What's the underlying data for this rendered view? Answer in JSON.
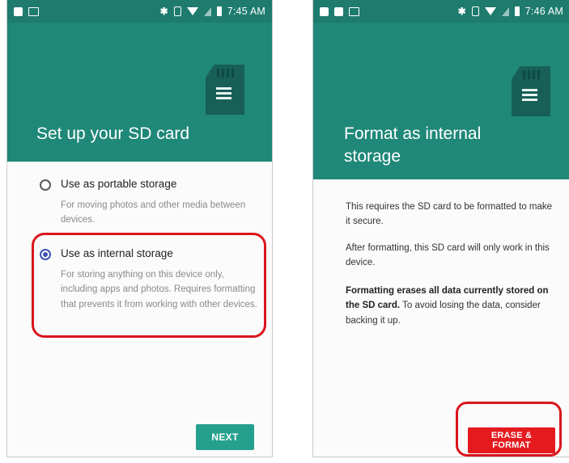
{
  "screen1": {
    "status": {
      "time": "7:45 AM",
      "left_icons": [
        "sim-icon",
        "image-icon"
      ],
      "right_icons": [
        "bluetooth-icon",
        "vibrate-icon",
        "wifi-icon",
        "signal-icon",
        "battery-icon"
      ]
    },
    "title": "Set up your SD card",
    "options": [
      {
        "label": "Use as portable storage",
        "description": "For moving photos and other media between devices.",
        "selected": false
      },
      {
        "label": "Use as internal storage",
        "description": "For storing anything on this device only, including apps and photos. Requires formatting that prevents it from working with other devices.",
        "selected": true
      }
    ],
    "next_label": "NEXT"
  },
  "screen2": {
    "status": {
      "time": "7:46 AM",
      "left_icons": [
        "photo-icon",
        "sim-icon",
        "image-icon"
      ],
      "right_icons": [
        "bluetooth-icon",
        "vibrate-icon",
        "wifi-icon",
        "signal-icon",
        "battery-icon"
      ]
    },
    "title": "Format as internal storage",
    "paragraph1": "This requires the SD card to be formatted to make it secure.",
    "paragraph2": "After formatting, this SD card will only work in this device.",
    "paragraph3_bold": "Formatting erases all data currently stored on the SD card.",
    "paragraph3_rest": " To avoid losing the data, consider backing it up.",
    "erase_label": "ERASE & FORMAT"
  },
  "colors": {
    "header": "#1f8878",
    "status_bar": "#1e7b6e",
    "next_button": "#25a08e",
    "erase_button": "#e41a1f",
    "radio_selected": "#3f51b5",
    "highlight": "#d9161c"
  }
}
